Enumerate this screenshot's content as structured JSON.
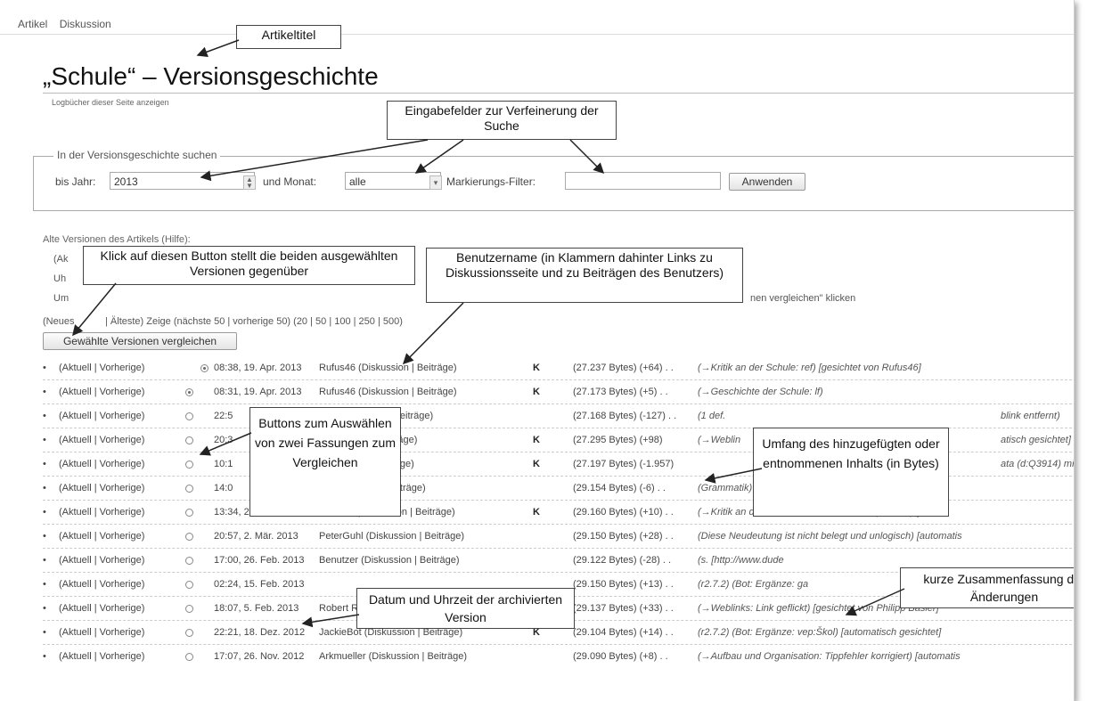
{
  "tabs": {
    "article": "Artikel",
    "discussion": "Diskussion"
  },
  "page_title": "„Schule“ – Versionsgeschichte",
  "log_link": "Logbücher dieser Seite anzeigen",
  "search": {
    "legend": "In der Versionsgeschichte suchen",
    "year_label": "bis Jahr:",
    "year_value": "2013",
    "month_label": "und Monat:",
    "month_value": "alle",
    "filter_label": "Markierungs-Filter:",
    "filter_value": "",
    "apply_label": "Anwenden"
  },
  "help": {
    "intro": "Alte Versionen des Artikels (Hilfe):",
    "bullet1": "(Ak",
    "bullet2": "Uh",
    "bullet3": "Um",
    "bullet3_tail": "nen vergleichen\" klicken"
  },
  "paging": {
    "left": "(Neues",
    "right": "| Älteste) Zeige (nächste 50 | vorherige 50) (20 | 50 | 100 | 250 | 500)"
  },
  "compare_button": "Gewählte Versionen vergleichen",
  "rows": [
    {
      "links": "(Aktuell | Vorherige)",
      "datetime": "08:38, 19. Apr. 2013",
      "user": "Rufus46 (Diskussion | Beiträge)",
      "minor": "K",
      "size": "(27.237 Bytes) (+64) . .",
      "summary": "(→Kritik an der Schule: ref) [gesichtet von Rufus46]"
    },
    {
      "links": "(Aktuell | Vorherige)",
      "datetime": "08:31, 19. Apr. 2013",
      "user": "Rufus46 (Diskussion | Beiträge)",
      "minor": "K",
      "size": "(27.173 Bytes) (+5) . .",
      "summary": "(→Geschichte der Schule: lf)"
    },
    {
      "links": "(Aktuell | Vorherige)",
      "datetime": "22:5",
      "user": "est (Diskussion | Beiträge)",
      "minor": "",
      "size": "(27.168 Bytes) (-127) . .",
      "summary": "(1 def.",
      "tail": "blink entfernt)"
    },
    {
      "links": "(Aktuell | Vorherige)",
      "datetime": "20:3",
      "user": "(Diskussion | Beiträge)",
      "minor": "K",
      "size": "(27.295 Bytes) (+98)",
      "summary": "(→Weblin",
      "tail": "atisch gesichtet]"
    },
    {
      "links": "(Aktuell | Vorherige)",
      "datetime": "10:1",
      "user": "Diskussion | Beiträge)",
      "minor": "K",
      "size": "(27.197 Bytes) (-1.957)",
      "summary": "",
      "tail": "ata (d:Q3914) mi"
    },
    {
      "links": "(Aktuell | Vorherige)",
      "datetime": "14:0",
      "user": "e (Diskussion | Beiträge)",
      "minor": "",
      "size": "(29.154 Bytes) (-6) . .",
      "summary": "(Grammatik)"
    },
    {
      "links": "(Aktuell | Vorherige)",
      "datetime": "13:34, 26. Mär. 2013",
      "user": "Nothere (Diskussion | Beiträge)",
      "minor": "K",
      "size": "(29.160 Bytes) (+10) . .",
      "summary": "(→Kritik an der Schule: +hinweis auf Hauptartikel) [autom"
    },
    {
      "links": "(Aktuell | Vorherige)",
      "datetime": "20:57, 2. Mär. 2013",
      "user": "PeterGuhl (Diskussion | Beiträge)",
      "minor": "",
      "size": "(29.150 Bytes) (+28) . .",
      "summary": "(Diese Neudeutung ist nicht belegt und unlogisch) [automatis"
    },
    {
      "links": "(Aktuell | Vorherige)",
      "datetime": "17:00, 26. Feb. 2013",
      "user": "Benutzer (Diskussion | Beiträge)",
      "minor": "",
      "size": "(29.122 Bytes) (-28) . .",
      "summary": "(s. [http://www.dude"
    },
    {
      "links": "(Aktuell | Vorherige)",
      "datetime": "02:24, 15. Feb. 2013",
      "user": "",
      "minor": "",
      "size": "(29.150 Bytes) (+13) . .",
      "summary": "(r2.7.2) (Bot: Ergänze: ga"
    },
    {
      "links": "(Aktuell | Vorherige)",
      "datetime": "18:07, 5. Feb. 2013",
      "user": "Robert Radke (Diskussion | Beiträge)",
      "minor": "",
      "size": "(29.137 Bytes) (+33) . .",
      "summary": "(→Weblinks: Link geflickt) [gesichtet von Philipp Basler]"
    },
    {
      "links": "(Aktuell | Vorherige)",
      "datetime": "22:21, 18. Dez. 2012",
      "user": "JackieBot (Diskussion | Beiträge)",
      "minor": "K",
      "size": "(29.104 Bytes) (+14) . .",
      "summary": "(r2.7.2) (Bot: Ergänze: vep:Škol) [automatisch gesichtet]"
    },
    {
      "links": "(Aktuell | Vorherige)",
      "datetime": "17:07, 26. Nov. 2012",
      "user": "Arkmueller (Diskussion | Beiträge)",
      "minor": "",
      "size": "(29.090 Bytes) (+8) . .",
      "summary": "(→Aufbau und Organisation: Tippfehler korrigiert) [automatis"
    }
  ],
  "annotations": {
    "article_title": "Artikeltitel",
    "input_fields": "Eingabefelder zur Verfeinerung der Suche",
    "compare_button": "Klick auf diesen Button stellt die beiden ausgewählten Versionen gegenüber",
    "username": "Benutzername (in Klammern dahinter Links zu Diskussionsseite und zu Beiträgen des Benutzers)",
    "radio_buttons": "Buttons zum Auswählen von zwei Fassungen zum Vergleichen",
    "size_change": "Umfang des hinzugefügten oder entnommenen Inhalts (in Bytes)",
    "summary": "kurze Zusammenfassung der Änderungen",
    "datetime": "Datum und Uhrzeit der archivierten Version"
  }
}
